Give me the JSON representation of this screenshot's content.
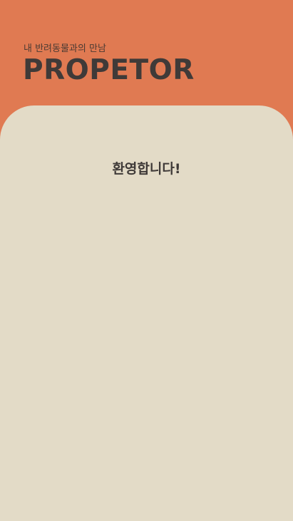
{
  "header": {
    "tagline": "내 반려동물과의 만남",
    "brand": "PROPETOR"
  },
  "main": {
    "welcome": "환영합니다!"
  },
  "colors": {
    "header_bg": "#E07A52",
    "card_bg": "#E3DBC7",
    "text_dark": "#3f3a38"
  }
}
